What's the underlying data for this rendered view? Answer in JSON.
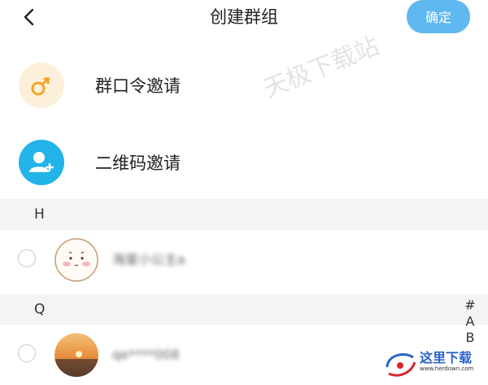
{
  "header": {
    "title": "创建群组",
    "confirm_label": "确定"
  },
  "invite_options": [
    {
      "label": "群口令邀请",
      "icon": "key-icon",
      "color": "#f5a623"
    },
    {
      "label": "二维码邀请",
      "icon": "add-user-icon",
      "color": "#22b3e8"
    }
  ],
  "sections": [
    {
      "letter": "H",
      "contacts": [
        {
          "name": "海棠小公主a"
        }
      ]
    },
    {
      "letter": "Q",
      "contacts": [
        {
          "name": "qe****008"
        }
      ]
    }
  ],
  "index_bar": [
    "#",
    "A",
    "B"
  ],
  "watermark": "天极下载站",
  "logo": {
    "text": "这里下载",
    "site": "www.herdown.com"
  }
}
